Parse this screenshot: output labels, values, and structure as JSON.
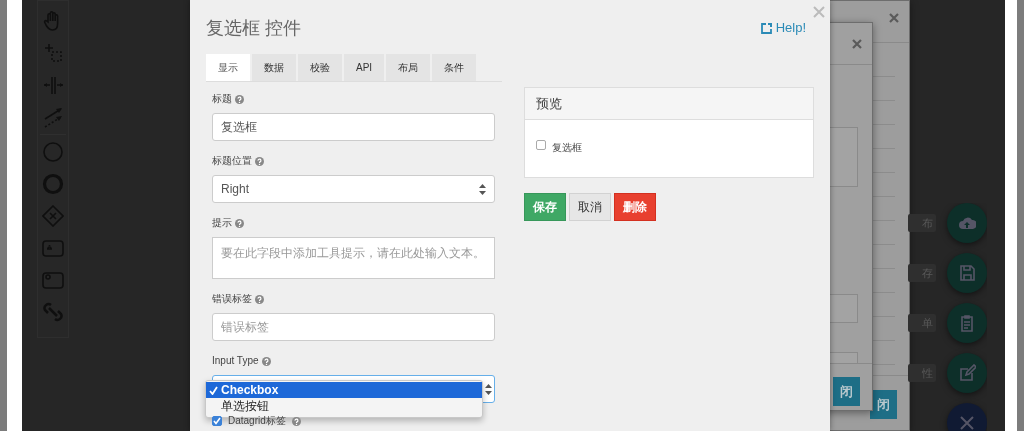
{
  "background_windows": [
    {
      "button": "闭"
    },
    {
      "button": "闭"
    }
  ],
  "fab_menu": [
    {
      "kind": "action",
      "tooltip": "布"
    },
    {
      "kind": "action",
      "tooltip": "存"
    },
    {
      "kind": "action",
      "tooltip": "单"
    },
    {
      "kind": "action",
      "tooltip": "性"
    },
    {
      "kind": "toggle"
    }
  ],
  "dialog": {
    "title": "复选框 控件",
    "help": "Help!",
    "tabs": [
      {
        "label": "显示",
        "selected": true
      },
      {
        "label": "数据",
        "selected": false
      },
      {
        "label": "校验",
        "selected": false
      },
      {
        "label": "API",
        "selected": false
      },
      {
        "label": "布局",
        "selected": false
      },
      {
        "label": "条件",
        "selected": false
      }
    ],
    "fields": [
      {
        "kind": "input",
        "label": "标题",
        "value": "复选框"
      },
      {
        "kind": "select",
        "label": "标题位置",
        "value": "Right"
      },
      {
        "kind": "textarea",
        "label": "提示",
        "placeholder": "要在此字段中添加工具提示，请在此处输入文本。"
      },
      {
        "kind": "input",
        "label": "错误标签",
        "placeholder": "错误标签"
      },
      {
        "kind": "select",
        "label": "Input Type",
        "options": [
          {
            "label": "Checkbox",
            "selected": true
          },
          {
            "label": "单选按钮",
            "selected": false
          }
        ]
      },
      {
        "kind": "checkbox",
        "label": "Datagrid标签",
        "checked": true
      }
    ],
    "preview": {
      "title": "预览",
      "checkbox": {
        "label": "复选框",
        "checked": false
      }
    },
    "buttons": [
      {
        "label": "保存",
        "kind": "success"
      },
      {
        "label": "取消",
        "kind": "default"
      },
      {
        "label": "删除",
        "kind": "danger"
      }
    ]
  }
}
